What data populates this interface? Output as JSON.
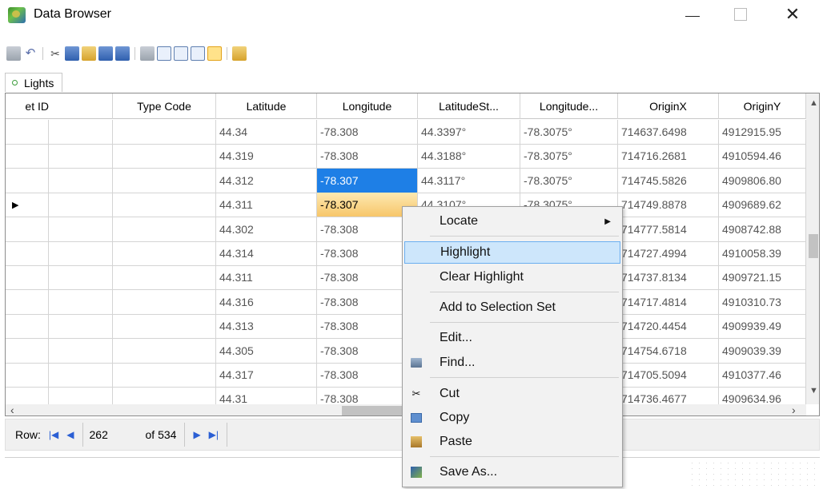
{
  "window": {
    "title": "Data Browser",
    "minimize": "—",
    "maximize": "☐",
    "close": "✕"
  },
  "tab": {
    "label": "Lights"
  },
  "columns": [
    "et ID",
    "Type Code",
    "Latitude",
    "Longitude",
    "LatitudeSt...",
    "Longitude...",
    "OriginX",
    "OriginY"
  ],
  "rows": [
    [
      "",
      "",
      "44.34",
      "-78.308",
      "44.3397°",
      "-78.3075°",
      "714637.6498",
      "4912915.95"
    ],
    [
      "",
      "",
      "44.319",
      "-78.308",
      "44.3188°",
      "-78.3075°",
      "714716.2681",
      "4910594.46"
    ],
    [
      "",
      "",
      "44.312",
      "-78.307",
      "44.3117°",
      "-78.3075°",
      "714745.5826",
      "4909806.80"
    ],
    [
      "",
      "",
      "44.311",
      "-78.307",
      "44.3107°",
      "-78.3075°",
      "714749.8878",
      "4909689.62"
    ],
    [
      "",
      "",
      "44.302",
      "-78.308",
      "",
      "",
      "714777.5814",
      "4908742.88"
    ],
    [
      "",
      "",
      "44.314",
      "-78.308",
      "",
      "",
      "714727.4994",
      "4910058.39"
    ],
    [
      "",
      "",
      "44.311",
      "-78.308",
      "",
      "",
      "714737.8134",
      "4909721.15"
    ],
    [
      "",
      "",
      "44.316",
      "-78.308",
      "",
      "",
      "714717.4814",
      "4910310.73"
    ],
    [
      "",
      "",
      "44.313",
      "-78.308",
      "",
      "",
      "714720.4454",
      "4909939.49"
    ],
    [
      "",
      "",
      "44.305",
      "-78.308",
      "",
      "",
      "714754.6718",
      "4909039.39"
    ],
    [
      "",
      "",
      "44.317",
      "-78.308",
      "",
      "",
      "714705.5094",
      "4910377.46"
    ],
    [
      "",
      "",
      "44.31",
      "-78.308",
      "",
      "",
      "714736.4677",
      "4909634.96"
    ]
  ],
  "navigator": {
    "row_label": "Row:",
    "current": "262",
    "of_label": "of 534"
  },
  "context_menu": {
    "locate": "Locate",
    "highlight": "Highlight",
    "clear_highlight": "Clear Highlight",
    "add_to_selection": "Add to Selection Set",
    "edit": "Edit...",
    "find": "Find...",
    "cut": "Cut",
    "copy": "Copy",
    "paste": "Paste",
    "save_as": "Save As..."
  },
  "icons": [
    "app-icon",
    "save-icon",
    "undo-icon",
    "cut-icon",
    "copy-icon",
    "paste-icon",
    "export-icon",
    "save-as-icon",
    "grid-icon",
    "table-icon",
    "columns-icon",
    "form-icon",
    "record-icon",
    "properties-icon"
  ],
  "colors": {
    "selection_blue": "#1e7fe6",
    "selection_yellow": "#f7c66a",
    "menu_highlight": "#cde6fb"
  }
}
